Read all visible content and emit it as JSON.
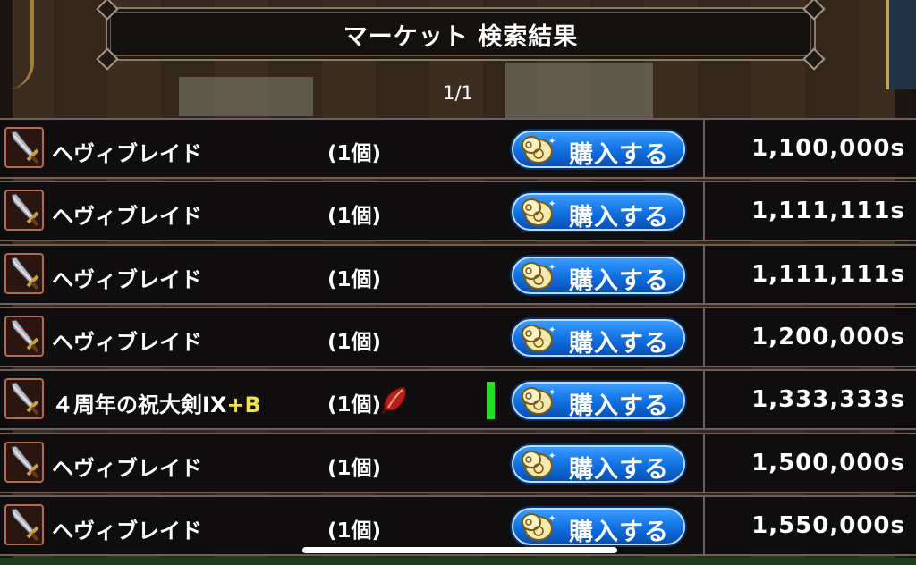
{
  "header": {
    "title": "マーケット 検索結果",
    "page": "1/1"
  },
  "buy_label": "購入する",
  "icons": {
    "item": "sword-icon",
    "buy": "coin-icon",
    "special": "red-feather-icon"
  },
  "colors": {
    "button": "#1a7ff0",
    "plus_text": "#f1e24a",
    "marker": "#22dd22"
  },
  "rows": [
    {
      "name": "ヘヴィブレイド",
      "plus": "",
      "qty": "(1個)",
      "price": "1,100,000s",
      "special": false,
      "marker": false
    },
    {
      "name": "ヘヴィブレイド",
      "plus": "",
      "qty": "(1個)",
      "price": "1,111,111s",
      "special": false,
      "marker": false
    },
    {
      "name": "ヘヴィブレイド",
      "plus": "",
      "qty": "(1個)",
      "price": "1,111,111s",
      "special": false,
      "marker": false
    },
    {
      "name": "ヘヴィブレイド",
      "plus": "",
      "qty": "(1個)",
      "price": "1,200,000s",
      "special": false,
      "marker": false
    },
    {
      "name": "４周年の祝大剣IX",
      "plus": "+B",
      "qty": "(1個)",
      "price": "1,333,333s",
      "special": true,
      "marker": true
    },
    {
      "name": "ヘヴィブレイド",
      "plus": "",
      "qty": "(1個)",
      "price": "1,500,000s",
      "special": false,
      "marker": false
    },
    {
      "name": "ヘヴィブレイド",
      "plus": "",
      "qty": "(1個)",
      "price": "1,550,000s",
      "special": false,
      "marker": false
    }
  ]
}
